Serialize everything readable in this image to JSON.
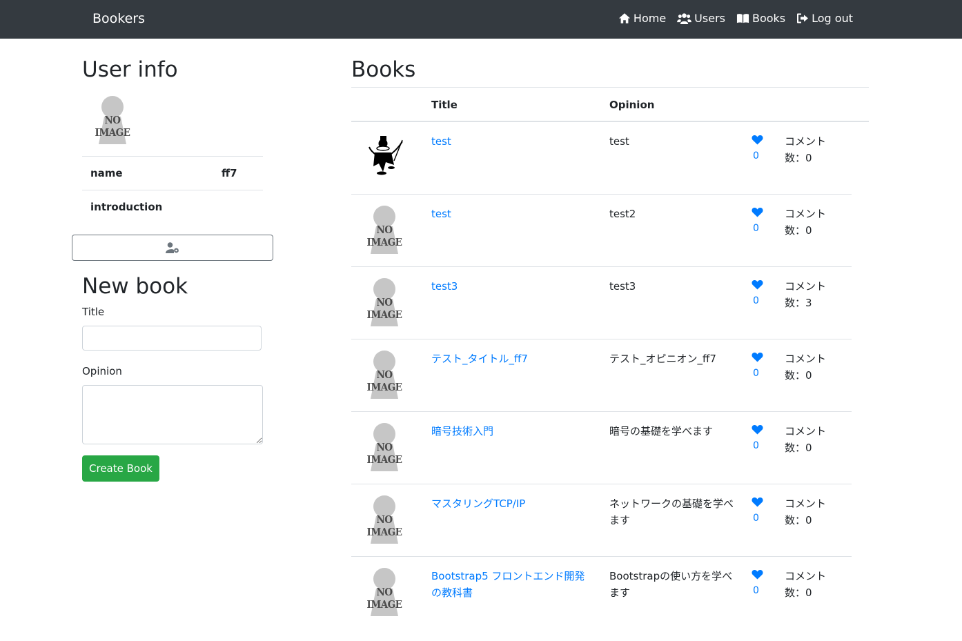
{
  "navbar": {
    "brand": "Bookers",
    "links": [
      {
        "label": "Home",
        "icon": "home-icon"
      },
      {
        "label": "Users",
        "icon": "users-icon"
      },
      {
        "label": "Books",
        "icon": "book-icon"
      },
      {
        "label": "Log out",
        "icon": "sign-out-icon"
      }
    ]
  },
  "user_info": {
    "heading": "User info",
    "image_text": "NO IMAGE",
    "rows": [
      {
        "label": "name",
        "value": "ff7"
      },
      {
        "label": "introduction",
        "value": ""
      }
    ],
    "edit_icon": "user-cog-icon"
  },
  "new_book": {
    "heading": "New book",
    "title_label": "Title",
    "title_value": "",
    "opinion_label": "Opinion",
    "opinion_value": "",
    "submit_label": "Create Book"
  },
  "books": {
    "heading": "Books",
    "columns": {
      "title": "Title",
      "opinion": "Opinion"
    },
    "rows": [
      {
        "title": "test",
        "opinion": "test",
        "favorites": "0",
        "comment": "コメント数：0",
        "image": "monopoly-man"
      },
      {
        "title": "test",
        "opinion": "test2",
        "favorites": "0",
        "comment": "コメント数：0",
        "image": "no-image"
      },
      {
        "title": "test3",
        "opinion": "test3",
        "favorites": "0",
        "comment": "コメント数：3",
        "image": "no-image"
      },
      {
        "title": "テスト_タイトル_ff7",
        "opinion": "テスト_オピニオン_ff7",
        "favorites": "0",
        "comment": "コメント数：0",
        "image": "no-image"
      },
      {
        "title": "暗号技術入門",
        "opinion": "暗号の基礎を学べます",
        "favorites": "0",
        "comment": "コメント数：0",
        "image": "no-image"
      },
      {
        "title": "マスタリングTCP/IP",
        "opinion": "ネットワークの基礎を学べます",
        "favorites": "0",
        "comment": "コメント数：0",
        "image": "no-image"
      },
      {
        "title": "Bootstrap5 フロントエンド開発の教科書",
        "opinion": "Bootstrapの使い方を学べます",
        "favorites": "0",
        "comment": "コメント数：0",
        "image": "no-image"
      }
    ]
  },
  "colors": {
    "navbar": "#343a40",
    "link": "#007bff",
    "success": "#28a745",
    "border": "#dee2e6"
  }
}
